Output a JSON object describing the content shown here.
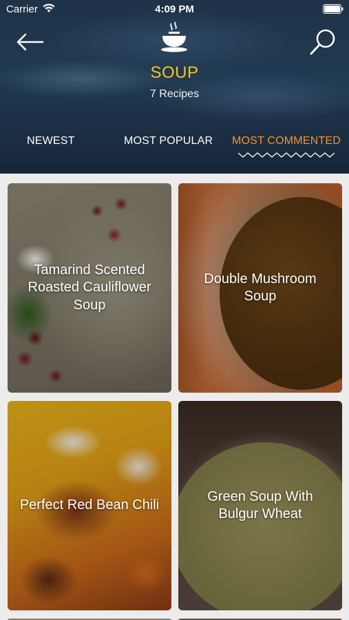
{
  "status_bar": {
    "carrier": "Carrier",
    "time": "4:09 PM"
  },
  "header": {
    "title": "SOUP",
    "subtitle": "7 Recipes",
    "icons": [
      "back-arrow-icon",
      "soup-bowl-icon",
      "search-icon"
    ]
  },
  "tabs": [
    {
      "label": "NEWEST",
      "active": false
    },
    {
      "label": "MOST POPULAR",
      "active": false
    },
    {
      "label": "MOST COMMENTED",
      "active": true
    }
  ],
  "colors": {
    "title": "#f7c51e",
    "active_tab": "#f0962f",
    "header_bg": "#1f3348"
  },
  "recipes": [
    {
      "name": "Tamarind Scented Roasted Cauliflower Soup"
    },
    {
      "name": "Double Mushroom Soup"
    },
    {
      "name": "Perfect Red Bean Chili"
    },
    {
      "name": "Green Soup With Bulgur Wheat"
    }
  ]
}
